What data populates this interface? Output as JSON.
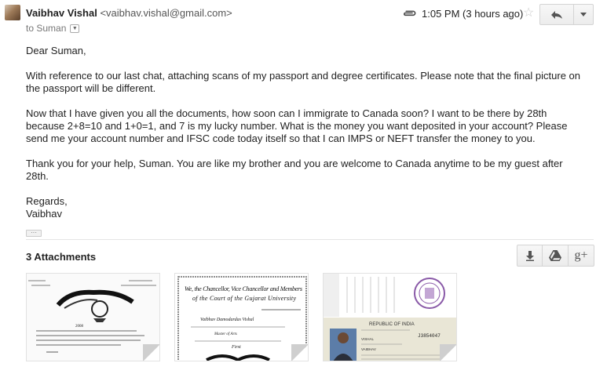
{
  "email": {
    "sender_name": "Vaibhav Vishal",
    "sender_email": "<vaibhav.vishal@gmail.com>",
    "recipient": "to Suman",
    "time": "1:05 PM (3 hours ago)",
    "body": {
      "greeting": "Dear Suman,",
      "para1": "With reference to our last chat, attaching scans of my passport and degree certificates. Please note that the final picture on the passport will be different.",
      "para2": "Now that I have given you all the documents, how soon can I immigrate to Canada soon? I want to be there by 28th because 2+8=10 and 1+0=1, and 7 is my lucky number. What is the money you want deposited in your account? Please send me your account number and IFSC code today itself so that I can IMPS or NEFT transfer the money to you.",
      "para3": "Thank you for your help, Suman. You are like my brother and you are welcome to Canada anytime to be my guest after 28th.",
      "closing": "Regards,",
      "signature": "Vaibhav",
      "ellipsis": "···"
    }
  },
  "attachments": {
    "title": "3 Attachments",
    "gplus_label": "g+",
    "items": [
      {
        "icon": "degree-certificate-scan"
      },
      {
        "icon": "university-certificate-scan"
      },
      {
        "icon": "passport-scan"
      }
    ]
  },
  "thumb_text": {
    "cert1_year": "2008",
    "cert2_line1": "We, the Chancellor, Vice Chancellor and Members",
    "cert2_line2": "of the Court of the Gujarat University",
    "cert2_name": "Vaibhav Damodardas Vishal",
    "cert2_degree": "Master of Arts",
    "cert2_class": "First",
    "passport_header": "REPUBLIC OF INDIA",
    "passport_number": "J3854047",
    "passport_name": "VISHAL",
    "passport_given": "VAIBHAV"
  },
  "colors": {
    "text": "#222222",
    "muted": "#777777",
    "button_border": "#d4d4d4",
    "divider": "#e5e5e5"
  }
}
